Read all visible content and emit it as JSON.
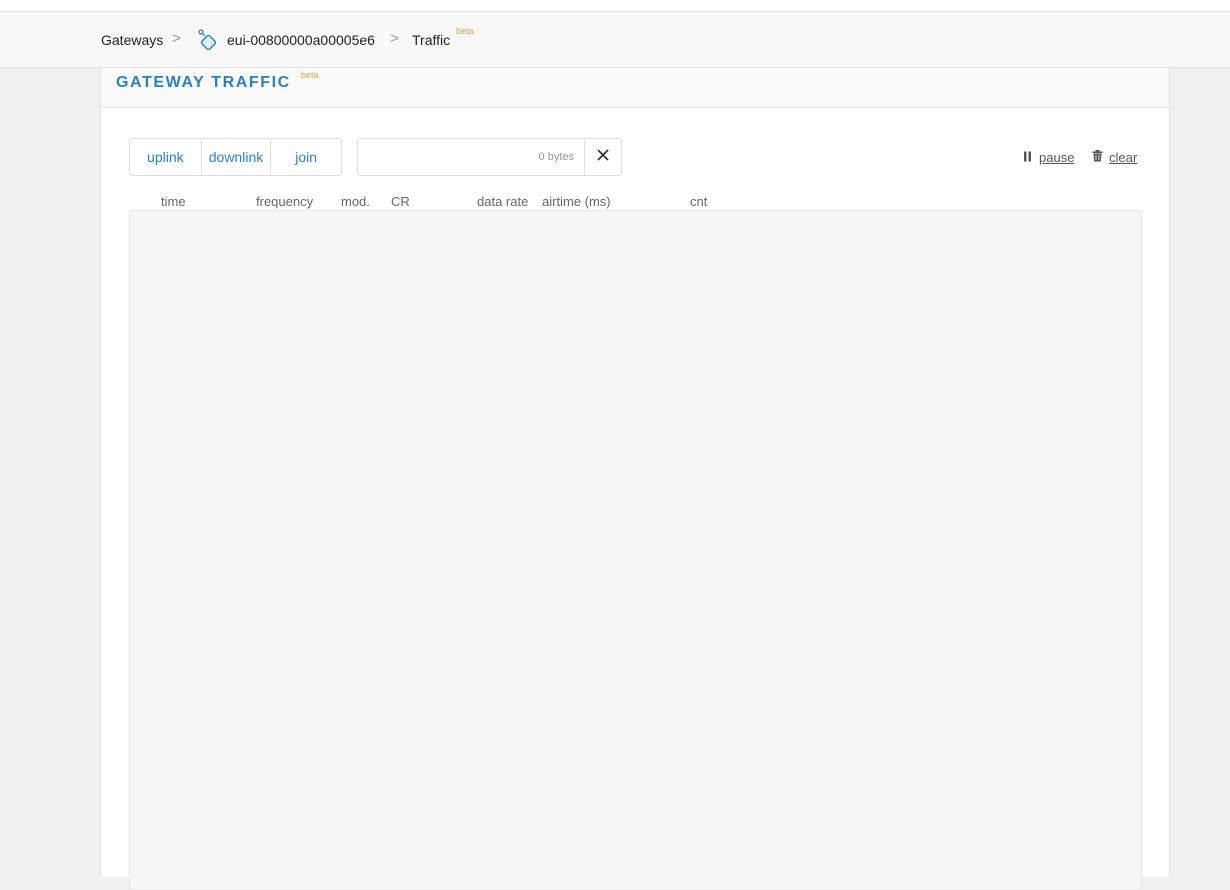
{
  "breadcrumb": {
    "gateways": "Gateways",
    "separator": ">",
    "gateway_id": "eui-00800000a00005e6",
    "traffic": "Traffic",
    "beta": "beta"
  },
  "panel": {
    "title": "GATEWAY TRAFFIC",
    "beta": "beta"
  },
  "filters": {
    "uplink": "uplink",
    "downlink": "downlink",
    "join": "join"
  },
  "search": {
    "value": "",
    "placeholder": "",
    "bytes": "0 bytes"
  },
  "actions": {
    "pause": "pause",
    "clear": "clear"
  },
  "columns": [
    "time",
    "frequency",
    "mod.",
    "CR",
    "data rate",
    "airtime (ms)",
    "cnt"
  ],
  "icons": {
    "gateway": "gateway-icon",
    "pause": "pause-icon",
    "clear": "trash-icon",
    "close": "close-icon"
  },
  "colors": {
    "accent": "#2c7fc1",
    "beta": "#f0a020"
  }
}
